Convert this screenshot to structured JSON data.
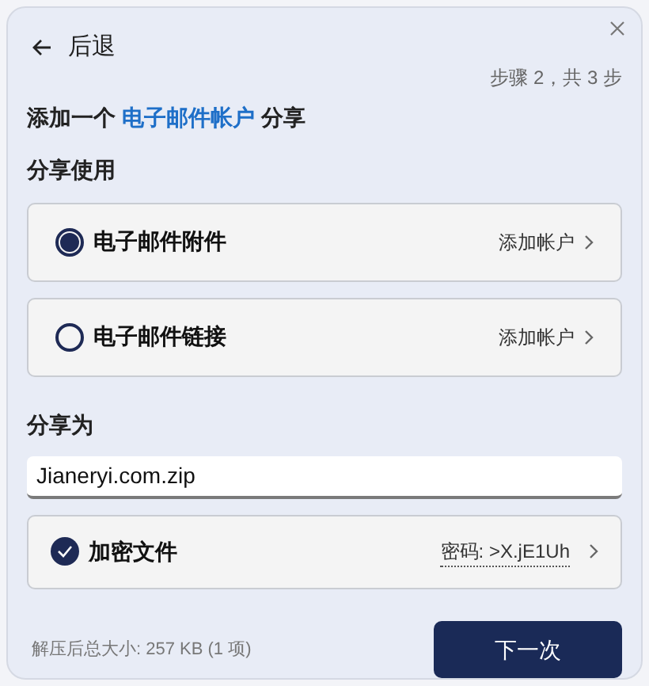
{
  "back": {
    "label": "后退"
  },
  "step": "步骤 2，共 3 步",
  "heading": {
    "prefix": "添加一个 ",
    "link": "电子邮件帐户",
    "suffix": " 分享"
  },
  "share_using": {
    "label": "分享使用",
    "options": [
      {
        "label": "电子邮件附件",
        "action": "添加帐户",
        "selected": true
      },
      {
        "label": "电子邮件链接",
        "action": "添加帐户",
        "selected": false
      }
    ]
  },
  "share_as": {
    "label": "分享为",
    "filename": "Jianeryi.com.zip"
  },
  "encrypt": {
    "label": "加密文件",
    "checked": true,
    "password": "密码: >X.jE1Uh"
  },
  "footer": {
    "size": "解压后总大小: 257 KB (1 项)",
    "next": "下一次"
  }
}
